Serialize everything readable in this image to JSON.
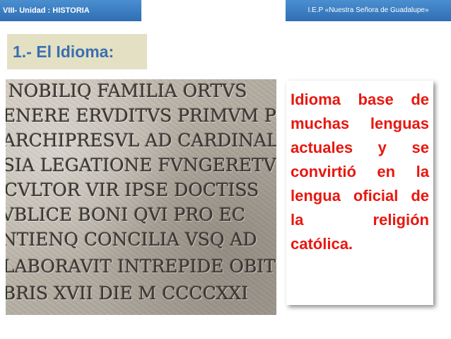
{
  "header": {
    "left_label": "VIII- Unidad : HISTORIA",
    "right_label": "I.E.P «Nuestra Señora de Guadalupe»"
  },
  "title": "1.- El Idioma:",
  "inscription": {
    "lines": [
      "NOBILIQ FAMILIA ORTVS",
      "ENERE ERVDITVS PRIMVM PRO",
      "ARCHIPRESVL AD CARDINALATV",
      "SIA LEGATIONE FVNGERETVR I",
      "CVLTOR VIR IPSE DOCTISS",
      "VBLICE BONI QVI PRO EC",
      "NTIENQ CONCILIA VSQ AD",
      "LABORAVIT INTREPIDE OBIT",
      "BRIS XVII DIE M CCCCXXI"
    ]
  },
  "description": "Idioma base de muchas lenguas actuales y se convirtió en la lengua oficial de la religión católica."
}
